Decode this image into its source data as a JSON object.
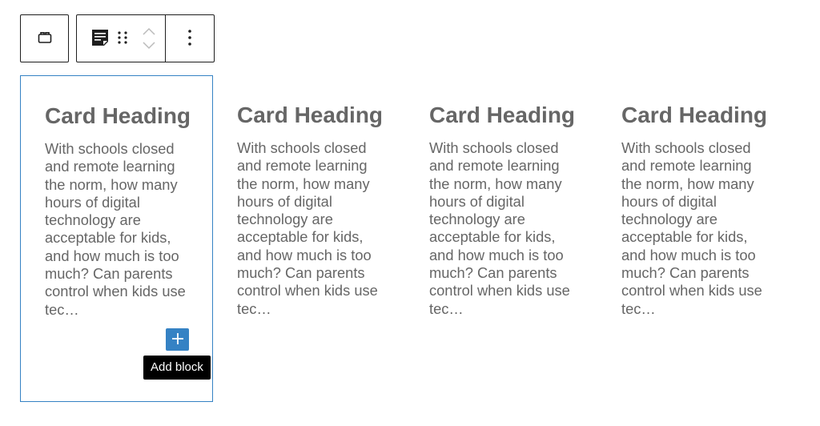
{
  "toolbar": {
    "parent_button_label": "Select parent block",
    "block_type_icon": "post-excerpt-icon",
    "drag_icon": "drag-handle-icon",
    "move_up_icon": "chevron-up-icon",
    "move_down_icon": "chevron-down-icon",
    "more_options_icon": "more-vertical-icon"
  },
  "cards": [
    {
      "heading": "Card Heading",
      "body": "With schools closed and remote learning the norm, how many hours of digital technology are acceptable for kids, and how much is too much? Can parents control when kids use tec…",
      "selected": true
    },
    {
      "heading": "Card Heading",
      "body": "With schools closed and remote learning the norm, how many hours of digital technology are acceptable for kids, and how much is too much? Can parents control when kids use tec…",
      "selected": false
    },
    {
      "heading": "Card Heading",
      "body": "With schools closed and remote learning the norm, how many hours of digital technology are acceptable for kids, and how much is too much? Can parents control when kids use tec…",
      "selected": false
    },
    {
      "heading": "Card Heading",
      "body": "With schools closed and remote learning the norm, how many hours of digital technology are acceptable for kids, and how much is too much? Can parents control when kids use tec…",
      "selected": false
    }
  ],
  "add_block": {
    "icon": "plus-icon",
    "tooltip": "Add block"
  },
  "colors": {
    "accent": "#3582c4",
    "text": "#666666",
    "toolbar_border": "#1e1e1e",
    "tooltip_bg": "#000000"
  }
}
